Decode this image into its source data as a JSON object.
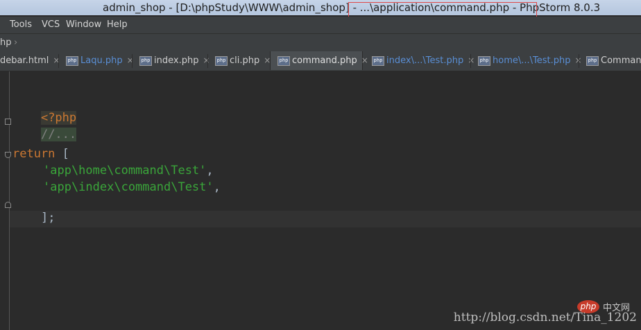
{
  "window": {
    "title": "admin_shop - [D:\\phpStudy\\WWW\\admin_shop] - ...\\application\\command.php - PhpStorm 8.0.3"
  },
  "menu": {
    "items": [
      "Tools",
      "VCS",
      "Window",
      "Help"
    ]
  },
  "breadcrumb": {
    "label": "hp"
  },
  "tabs": [
    {
      "label": "debar.html",
      "icon": "html-file-icon"
    },
    {
      "label": "Laqu.php",
      "icon": "php-file-icon"
    },
    {
      "label": "index.php",
      "icon": "php-file-icon"
    },
    {
      "label": "cli.php",
      "icon": "php-file-icon"
    },
    {
      "label": "command.php",
      "icon": "php-file-icon"
    },
    {
      "label": "index\\...\\Test.php",
      "icon": "php-file-icon"
    },
    {
      "label": "home\\...\\Test.php",
      "icon": "php-file-icon"
    },
    {
      "label": "Command.",
      "icon": "php-file-icon"
    }
  ],
  "editor": {
    "lines": {
      "php_open": "<?php",
      "comment": "//...",
      "return_kw": "return",
      "bracket_open": " [",
      "item1": "'app\\home\\command\\Test'",
      "item2": "'app\\index\\command\\Test'",
      "comma": ",",
      "close": "];"
    }
  },
  "watermark": {
    "url": "http://blog.csdn.net/Tina_1202",
    "logo_text": "php",
    "cn_text": "中文网"
  },
  "colors": {
    "keyword": "#cc7832",
    "string": "#3aa63a",
    "editor_bg": "#2b2b2b",
    "highlight_box": "#e04848"
  }
}
